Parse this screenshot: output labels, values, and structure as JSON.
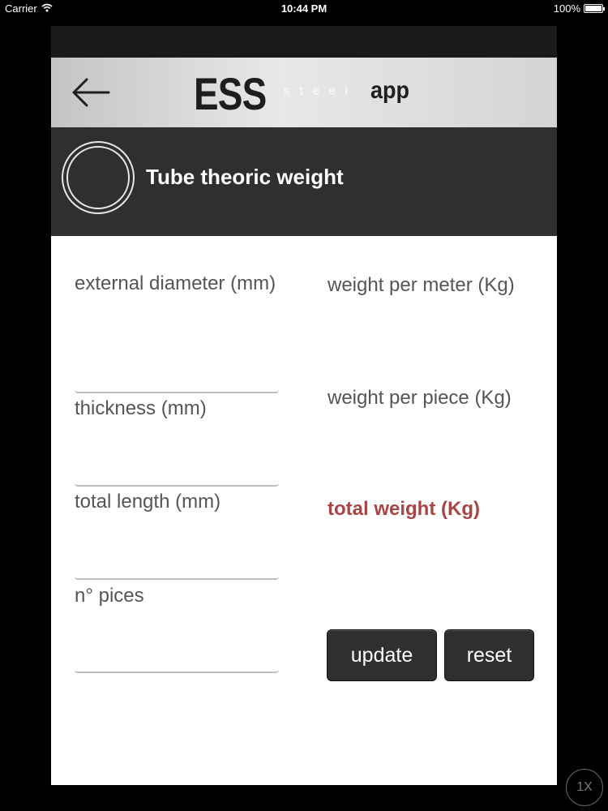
{
  "status_bar": {
    "carrier": "Carrier",
    "time": "10:44 PM",
    "battery": "100%"
  },
  "header": {
    "logo_main": "ESS",
    "logo_sub": "steel",
    "logo_app": "app"
  },
  "title_band": {
    "title": "Tube theoric weight"
  },
  "inputs": {
    "external_diameter_label": "external diameter (mm)",
    "external_diameter_value": "",
    "thickness_label": "thickness (mm)",
    "thickness_value": "",
    "total_length_label": "total length (mm)",
    "total_length_value": "",
    "pieces_label": "n° pices",
    "pieces_value": ""
  },
  "results": {
    "weight_per_meter_label": "weight per meter (Kg)",
    "weight_per_piece_label": "weight per piece (Kg)",
    "total_weight_label": "total weight (Kg)"
  },
  "buttons": {
    "update_label": "update",
    "reset_label": "reset"
  },
  "overlay": {
    "zoom_label": "1X"
  },
  "colors": {
    "header_band": "#2f2f2f",
    "total_weight_accent": "#a84545",
    "button_bg": "#2f2f2f"
  },
  "icons": {
    "back": "arrow-left-icon",
    "tube": "tube-icon",
    "wifi": "wifi-icon",
    "battery": "battery-icon"
  }
}
